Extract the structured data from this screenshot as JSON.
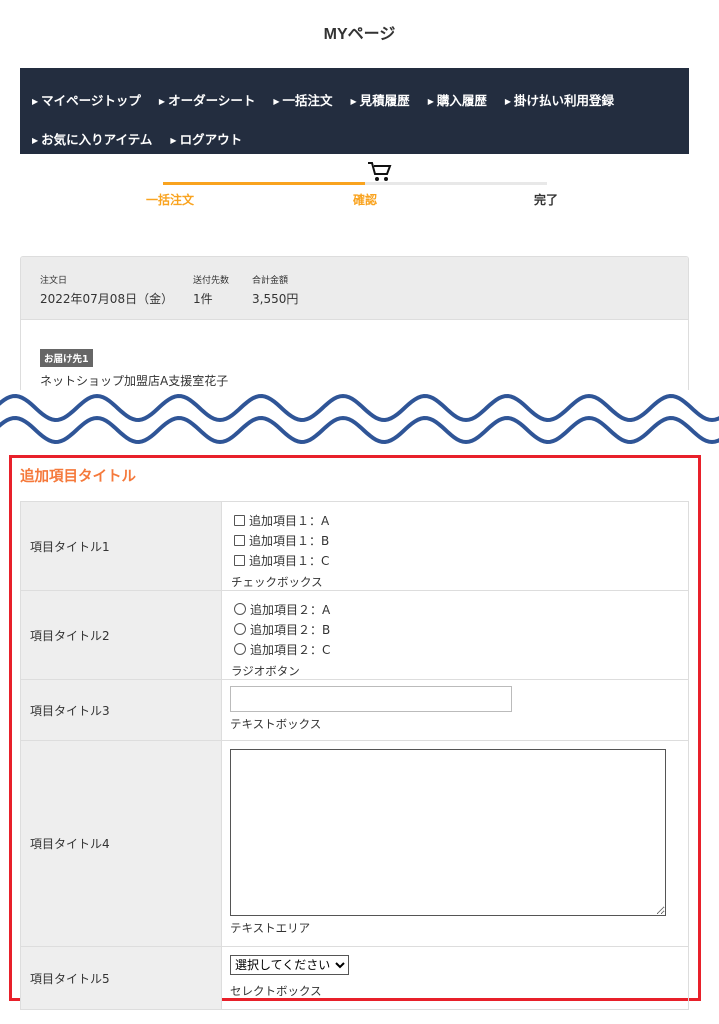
{
  "page_title": "MYページ",
  "nav": {
    "items": [
      "マイページトップ",
      "オーダーシート",
      "一括注文",
      "見積履歴",
      "購入履歴",
      "掛け払い利用登録",
      "お気に入りアイテム",
      "ログアウト"
    ]
  },
  "steps": [
    "一括注文",
    "確認",
    "完了"
  ],
  "order": {
    "date_label": "注文日",
    "date": "2022年07月08日（金）",
    "dest_count_label": "送付先数",
    "dest_count": "1件",
    "total_label": "合計金額",
    "total": "3,550円",
    "badge": "お届け先1",
    "recipient": "ネットショップ加盟店A支援室花子"
  },
  "extra": {
    "title": "追加項目タイトル",
    "rows": [
      {
        "label": "項目タイトル1",
        "options": [
          "追加項目１：A",
          "追加項目１：B",
          "追加項目１：C"
        ],
        "hint": "チェックボックス"
      },
      {
        "label": "項目タイトル2",
        "options": [
          "追加項目２：A",
          "追加項目２：B",
          "追加項目２：C"
        ],
        "hint": "ラジオボタン"
      },
      {
        "label": "項目タイトル3",
        "hint": "テキストボックス"
      },
      {
        "label": "項目タイトル4",
        "hint": "テキストエリア"
      },
      {
        "label": "項目タイトル5",
        "select_value": "選択してください",
        "hint": "セレクトボックス"
      }
    ]
  },
  "colors": {
    "nav_bg": "#232d3f",
    "accent": "#f9a31f",
    "highlight": "#e8202a",
    "wave": "#2f5597"
  }
}
